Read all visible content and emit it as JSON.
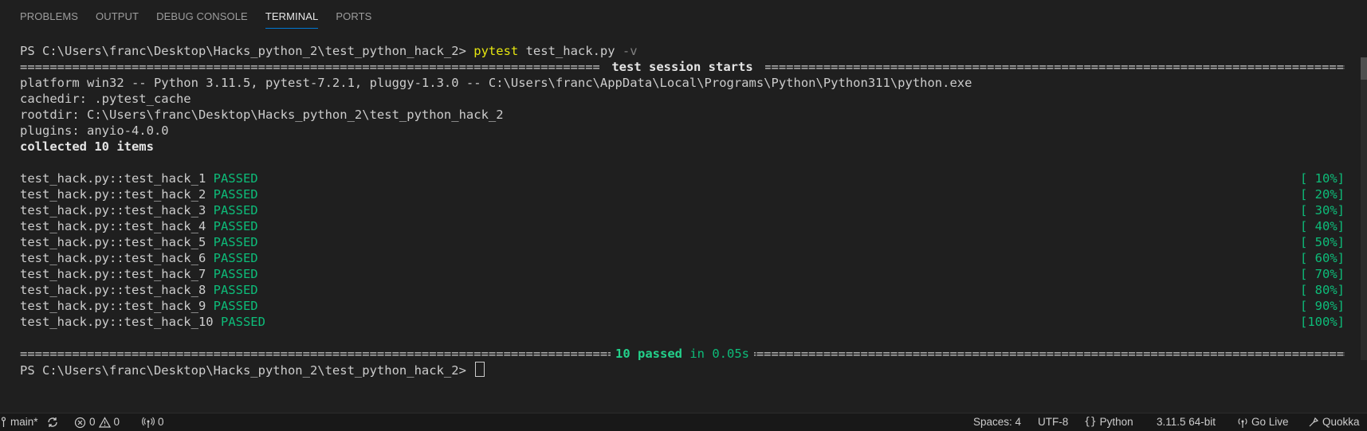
{
  "tabs": [
    {
      "label": "PROBLEMS"
    },
    {
      "label": "OUTPUT"
    },
    {
      "label": "DEBUG CONSOLE"
    },
    {
      "label": "TERMINAL"
    },
    {
      "label": "PORTS"
    }
  ],
  "terminal": {
    "prompt": "PS C:\\Users\\franc\\Desktop\\Hacks_python_2\\test_python_hack_2> ",
    "command": "pytest",
    "command_args": " test_hack.py ",
    "command_flag": "-v",
    "session_header": " test session starts ",
    "platform": "platform win32 -- Python 3.11.5, pytest-7.2.1, pluggy-1.3.0 -- C:\\Users\\franc\\AppData\\Local\\Programs\\Python\\Python311\\python.exe",
    "cachedir": "cachedir: .pytest_cache",
    "rootdir": "rootdir: C:\\Users\\franc\\Desktop\\Hacks_python_2\\test_python_hack_2",
    "plugins": "plugins: anyio-4.0.0",
    "collected": "collected 10 items",
    "results": [
      {
        "name": "test_hack.py::test_hack_1",
        "status": "PASSED",
        "pct": "[ 10%]"
      },
      {
        "name": "test_hack.py::test_hack_2",
        "status": "PASSED",
        "pct": "[ 20%]"
      },
      {
        "name": "test_hack.py::test_hack_3",
        "status": "PASSED",
        "pct": "[ 30%]"
      },
      {
        "name": "test_hack.py::test_hack_4",
        "status": "PASSED",
        "pct": "[ 40%]"
      },
      {
        "name": "test_hack.py::test_hack_5",
        "status": "PASSED",
        "pct": "[ 50%]"
      },
      {
        "name": "test_hack.py::test_hack_6",
        "status": "PASSED",
        "pct": "[ 60%]"
      },
      {
        "name": "test_hack.py::test_hack_7",
        "status": "PASSED",
        "pct": "[ 70%]"
      },
      {
        "name": "test_hack.py::test_hack_8",
        "status": "PASSED",
        "pct": "[ 80%]"
      },
      {
        "name": "test_hack.py::test_hack_9",
        "status": "PASSED",
        "pct": "[ 90%]"
      },
      {
        "name": "test_hack.py::test_hack_10",
        "status": "PASSED",
        "pct": "[100%]"
      }
    ],
    "summary_passed": "10 passed",
    "summary_time": " in 0.05s"
  },
  "statusbar": {
    "branch": "main*",
    "errors": "0",
    "warnings": "0",
    "ports": "0",
    "spaces": "Spaces: 4",
    "encoding": "UTF-8",
    "language": "Python",
    "interpreter": "3.11.5 64-bit",
    "go_live": "Go Live",
    "quokka": "Quokka"
  },
  "colors": {
    "background": "#1f1f1f",
    "accent": "#0078d4",
    "passed": "#0dbc79",
    "command": "#e5e510"
  }
}
